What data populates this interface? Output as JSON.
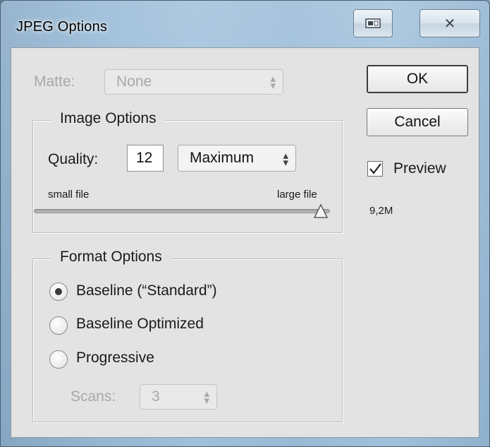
{
  "window": {
    "title": "JPEG Options"
  },
  "titlebar": {
    "restore_label": "",
    "close_label": "✕"
  },
  "matte": {
    "label": "Matte:",
    "value": "None"
  },
  "image_options": {
    "legend": "Image Options",
    "quality_label": "Quality:",
    "quality_value": "12",
    "quality_preset": "Maximum",
    "slider_min_label": "small file",
    "slider_max_label": "large file",
    "slider_fraction": 1.0
  },
  "format_options": {
    "legend": "Format Options",
    "radios": [
      {
        "label": "Baseline (“Standard”)",
        "selected": true
      },
      {
        "label": "Baseline Optimized",
        "selected": false
      },
      {
        "label": "Progressive",
        "selected": false
      }
    ],
    "scans_label": "Scans:",
    "scans_value": "3"
  },
  "buttons": {
    "ok": "OK",
    "cancel": "Cancel"
  },
  "preview": {
    "label": "Preview",
    "checked": true
  },
  "file_size": "9,2M"
}
